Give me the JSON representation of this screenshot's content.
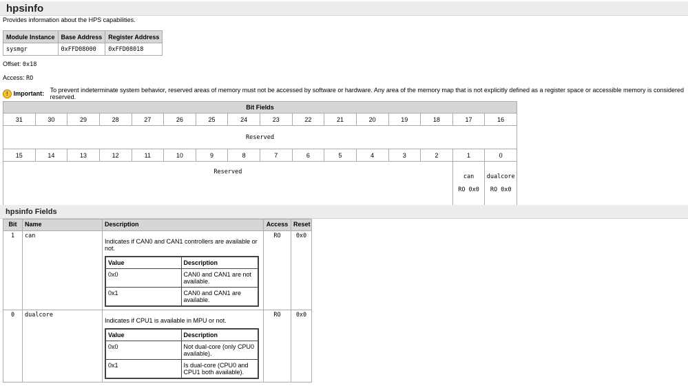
{
  "title": "hpsinfo",
  "description": "Provides information about the HPS capabilities.",
  "module_table": {
    "headers": [
      "Module Instance",
      "Base Address",
      "Register Address"
    ],
    "row": [
      "sysmgr",
      "0xFFD08000",
      "0xFFD08018"
    ]
  },
  "offset_label": "Offset:",
  "offset": "0x18",
  "access_label": "Access:",
  "access": "RO",
  "important_label": "Important:",
  "important_text": "To prevent indeterminate system behavior, reserved areas of memory must not be accessed by software or hardware. Any area of the memory map that is not explicitly defined as a register space or accessible memory is considered reserved.",
  "bit_fields": {
    "title": "Bit Fields",
    "high_bits": [
      "31",
      "30",
      "29",
      "28",
      "27",
      "26",
      "25",
      "24",
      "23",
      "22",
      "21",
      "20",
      "19",
      "18",
      "17",
      "16"
    ],
    "high_reserved": "Reserved",
    "low_bits": [
      "15",
      "14",
      "13",
      "12",
      "11",
      "10",
      "9",
      "8",
      "7",
      "6",
      "5",
      "4",
      "3",
      "2",
      "1",
      "0"
    ],
    "low_reserved": "Reserved",
    "can": {
      "name": "can",
      "access": "RO 0x0"
    },
    "dualcore": {
      "name": "dualcore",
      "access": "RO 0x0"
    }
  },
  "fields": {
    "title": "hpsinfo Fields",
    "headers": [
      "Bit",
      "Name",
      "Description",
      "Access",
      "Reset"
    ],
    "rows": [
      {
        "bit": "1",
        "name": "can",
        "desc": "Indicates if CAN0 and CAN1 controllers are available or not.",
        "access": "RO",
        "reset": "0x0",
        "vh": [
          "Value",
          "Description"
        ],
        "values": [
          {
            "v": "0x0",
            "d": "CAN0 and CAN1 are not available."
          },
          {
            "v": "0x1",
            "d": "CAN0 and CAN1 are available."
          }
        ]
      },
      {
        "bit": "0",
        "name": "dualcore",
        "desc": "Indicates if CPU1 is available in MPU or not.",
        "access": "RO",
        "reset": "0x0",
        "vh": [
          "Value",
          "Description"
        ],
        "values": [
          {
            "v": "0x0",
            "d": "Not dual-core (only CPU0 available)."
          },
          {
            "v": "0x1",
            "d": "Is dual-core (CPU0 and CPU1 both available)."
          }
        ]
      }
    ]
  }
}
